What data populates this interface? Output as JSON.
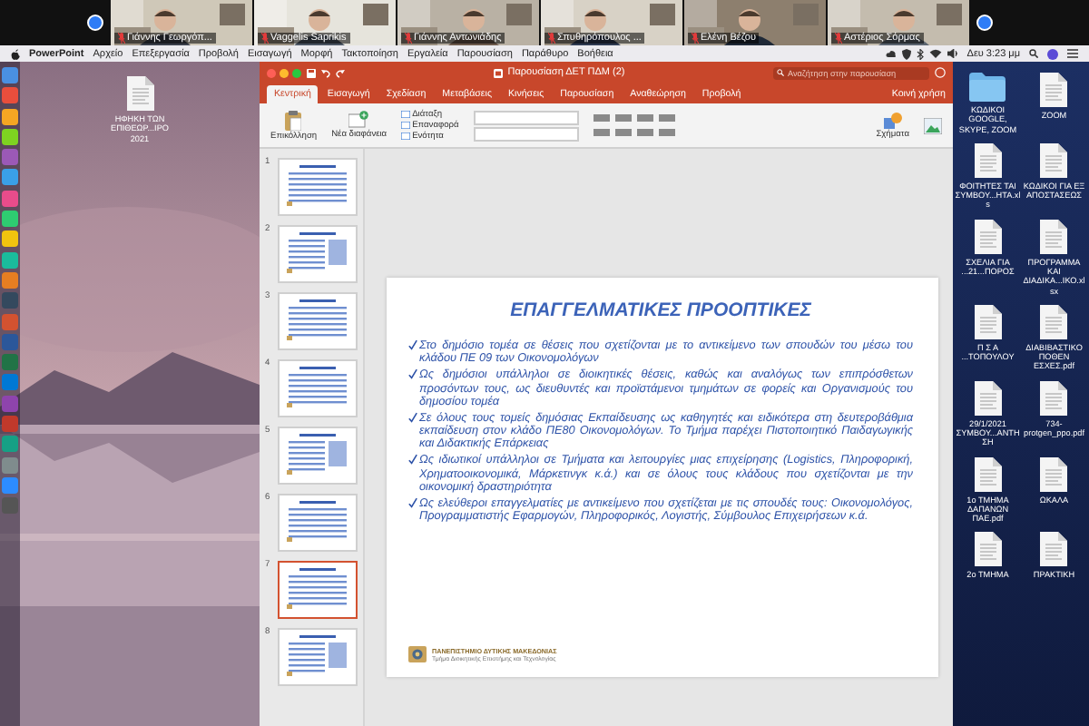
{
  "video_call": {
    "participants": [
      {
        "name": "Γιάννης Γεωργόπ...",
        "muted": true
      },
      {
        "name": "Vaggelis Saprikis",
        "muted": true
      },
      {
        "name": "Γιάννης Αντωνιάδης",
        "muted": true
      },
      {
        "name": "Σπυθηρόπουλος ...",
        "muted": true
      },
      {
        "name": "Ελένη Βέζου",
        "muted": true
      },
      {
        "name": "Αστέριος Σόρμας",
        "muted": true
      }
    ]
  },
  "menu_bar": {
    "app": "PowerPoint",
    "items": [
      "Αρχείο",
      "Επεξεργασία",
      "Προβολή",
      "Εισαγωγή",
      "Μορφή",
      "Τακτοποίηση",
      "Εργαλεία",
      "Παρουσίαση",
      "Παράθυρο",
      "Βοήθεια"
    ],
    "clock": "Δευ 3:23 μμ"
  },
  "desktop": {
    "left_icons": [
      {
        "label": "ΗΦΗΚΗ ΤΩΝ ΕΠΙΘΕΩΡ...ΙΡΟ 2021",
        "kind": "document"
      }
    ],
    "right_icons": [
      {
        "label": "ΚΩΔΙΚΟΙ GOOGLE, SKYPE, ZOOM",
        "kind": "folder"
      },
      {
        "label": "ZOOM",
        "kind": "document"
      },
      {
        "label": "ΦΟΙΤΗΤΕΣ ΤΑΙ ΣΥΜΒΟΥ...ΗΤΑ.xls",
        "kind": "document"
      },
      {
        "label": "ΚΩΔΙΚΟΙ ΓΙΑ ΕΞ ΑΠΟΣΤΑΣΕΩΣ",
        "kind": "document"
      },
      {
        "label": "ΣΧΕΛΙΑ ΓΙΑ ...21...ΠΟΡΟΣ",
        "kind": "document"
      },
      {
        "label": "ΠΡΟΓΡΑΜΜΑ ΚΑΙ ΔΙΑΔΙΚΑ...ΙΚΟ.xlsx",
        "kind": "document"
      },
      {
        "label": "Π Σ Α ...ΤΟΠΟΥΛΟΥ",
        "kind": "document"
      },
      {
        "label": "ΔΙΑΒΙΒΑΣΤΙΚΟ ΠΟΘΕΝ ΕΣΧΕΣ.pdf",
        "kind": "document"
      },
      {
        "label": "29/1/2021 ΣΥΜΒΟΥ...ΑΝΤΗΣΗ",
        "kind": "document"
      },
      {
        "label": "734-protgen_ppo.pdf",
        "kind": "document"
      },
      {
        "label": "1ο ΤΜΗΜΑ ΔΑΠΑΝΩΝ ΠΑΕ.pdf",
        "kind": "document"
      },
      {
        "label": "ΩΚΑΛΑ",
        "kind": "document"
      },
      {
        "label": "2ο ΤΜΗΜΑ",
        "kind": "document"
      },
      {
        "label": "ΠΡΑΚΤΙΚΗ",
        "kind": "document"
      }
    ]
  },
  "powerpoint": {
    "title": "Παρουσίαση ΔΕΤ ΠΔΜ (2)",
    "search": {
      "placeholder": "Αναζήτηση στην παρουσίαση"
    },
    "tabs": [
      {
        "label": "Κεντρική",
        "selected": true
      },
      {
        "label": "Εισαγωγή",
        "selected": false
      },
      {
        "label": "Σχεδίαση",
        "selected": false
      },
      {
        "label": "Μεταβάσεις",
        "selected": false
      },
      {
        "label": "Κινήσεις",
        "selected": false
      },
      {
        "label": "Παρουσίαση",
        "selected": false
      },
      {
        "label": "Αναθεώρηση",
        "selected": false
      },
      {
        "label": "Προβολή",
        "selected": false
      }
    ],
    "share": "Κοινή χρήση",
    "ribbon": {
      "paste": "Επικόλληση",
      "new_slide": "Νέα διαφάνεια",
      "small": [
        "Διάταξη",
        "Επαναφορά",
        "Ενότητα"
      ],
      "shapes": "Σχήματα"
    },
    "thumbnails": [
      {
        "number": "1",
        "selected": false
      },
      {
        "number": "2",
        "selected": false
      },
      {
        "number": "3",
        "selected": false
      },
      {
        "number": "4",
        "selected": false
      },
      {
        "number": "5",
        "selected": false
      },
      {
        "number": "6",
        "selected": false
      },
      {
        "number": "7",
        "selected": true
      },
      {
        "number": "8",
        "selected": false
      }
    ],
    "slide": {
      "title": "ΕΠΑΓΓΕΛΜΑΤΙΚΕΣ ΠΡΟΟΠΤΙΚΕΣ",
      "bullets": [
        "Στο δημόσιο τομέα σε θέσεις που σχετίζονται με το αντικείμενο των σπουδών του μέσω του κλάδου ΠΕ 09 των Οικονομολόγων",
        "Ως δημόσιοι υπάλληλοι σε διοικητικές θέσεις, καθώς και αναλόγως των επιπρόσθετων προσόντων τους, ως διευθυντές και προϊστάμενοι τμημάτων σε φορείς και Οργανισμούς του δημοσίου τομέα",
        "Σε όλους τους τομείς δημόσιας Εκπαίδευσης ως καθηγητές και ειδικότερα στη δευτεροβάθμια εκπαίδευση στον κλάδο ΠΕ80 Οικονομολόγων. Το Τμήμα παρέχει Πιστοποιητικό Παιδαγωγικής και Διδακτικής Επάρκειας",
        "Ως ιδιωτικοί υπάλληλοι σε Τμήματα και λειτουργίες μιας επιχείρησης (Logistics, Πληροφορική, Χρηματοοικονομικά, Μάρκετινγκ κ.ά.) και σε όλους τους κλάδους που σχετίζονται με την οικονομική δραστηριότητα",
        "Ως ελεύθεροι επαγγελματίες με αντικείμενο που σχετίζεται με τις σπουδές τους: Οικονομολόγος, Προγραμματιστής Εφαρμογών, Πληροφορικός, Λογιστής, Σύμβουλος Επιχειρήσεων κ.ά."
      ],
      "logo_lines": [
        "ΠΑΝΕΠΙΣΤΗΜΙΟ ΔΥΤΙΚΗΣ ΜΑΚΕΔΟΝΙΑΣ",
        "Τμήμα Διοικητικής Επιστήμης και Τεχνολογίας"
      ]
    }
  }
}
